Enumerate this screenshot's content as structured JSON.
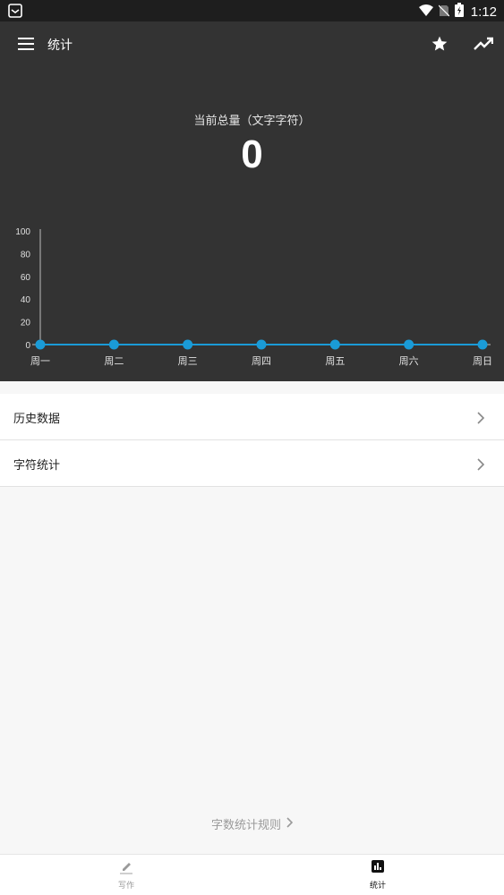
{
  "status_bar": {
    "time": "1:12"
  },
  "app_bar": {
    "title": "统计"
  },
  "summary": {
    "label": "当前总量（文字字符）",
    "value": "0"
  },
  "chart_data": {
    "type": "line",
    "categories": [
      "周一",
      "周二",
      "周三",
      "周四",
      "周五",
      "周六",
      "周日"
    ],
    "values": [
      0,
      0,
      0,
      0,
      0,
      0,
      0
    ],
    "yticks": [
      0,
      20,
      40,
      60,
      80,
      100
    ],
    "ylim": [
      0,
      100
    ],
    "line_color": "#1a9bd7",
    "grid": false
  },
  "list": [
    {
      "label": "历史数据"
    },
    {
      "label": "字符统计"
    }
  ],
  "rules_link": "字数统计规则",
  "bottom_nav": {
    "write_label": "写作",
    "stats_label": "统计"
  },
  "colors": {
    "accent": "#1a9bd7",
    "dark_bg": "#333333",
    "status_bg": "#1e1e1e"
  }
}
